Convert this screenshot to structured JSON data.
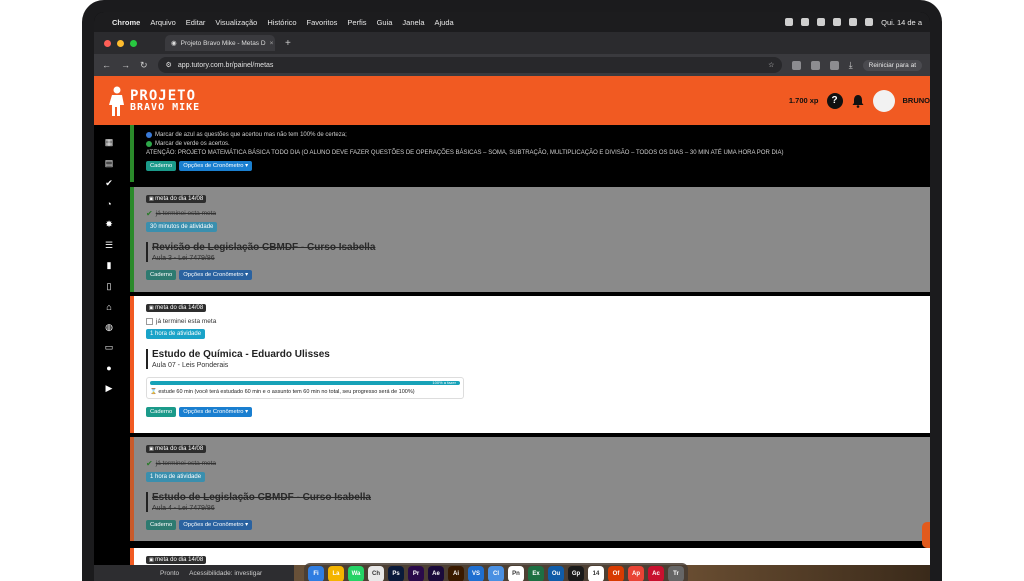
{
  "menubar": {
    "app": "Chrome",
    "items": [
      "Arquivo",
      "Editar",
      "Visualização",
      "Histórico",
      "Favoritos",
      "Perfis",
      "Guia",
      "Janela",
      "Ajuda"
    ],
    "clock": "Qui. 14 de a"
  },
  "browser": {
    "tab_title": "Projeto Bravo Mike - Metas D",
    "url": "app.tutory.com.br/painel/metas",
    "relaunch_label": "Reiniciar para at"
  },
  "header": {
    "logo_line1": "PROJETO",
    "logo_line2": "BRAVO MIKE",
    "xp": "1.700 xp",
    "help": "?",
    "user": "BRUNO"
  },
  "top_card": {
    "line1": "Marcar de azul as questões que acertou mas não tem 100% de certeza;",
    "line2": "Marcar de verde os acertos.",
    "line3": "ATENÇÃO: PROJETO MATEMÁTICA BÁSICA TODO DIA (O ALUNO DEVE FAZER QUESTÕES DE OPERAÇÕES BÁSICAS – SOMA, SUBTRAÇÃO, MULTIPLICAÇÃO E DIVISÃO – TODOS OS DIAS – 30 MIN ATÉ UMA HORA POR DIA)",
    "btn_caderno": "Caderno",
    "btn_cronometro": "Opções de Cronômetro ▾"
  },
  "cards": [
    {
      "date": "meta do dia 14/08",
      "check": "já terminei esta meta",
      "time": "30 minutos de atividade",
      "title": "Revisão de Legislação CBMDF - Curso Isabella",
      "sub": "Aula 3 - Lei 7479/86",
      "btn_caderno": "Caderno",
      "btn_cronometro": "Opções de Cronômetro ▾"
    },
    {
      "date": "meta do dia 14/08",
      "check": "já terminei esta meta",
      "time": "1 hora de atividade",
      "title": "Estudo de Química - Eduardo Ulisses",
      "sub": "Aula 07 - Leis Ponderais",
      "progress_label": "100% a fazer",
      "progress_value": 100,
      "progress_note": "⌛ estude 60 min (você terá estudado 60 min e o assunto tem 60 min no total, seu progresso será de 100%)",
      "btn_caderno": "Caderno",
      "btn_cronometro": "Opções de Cronômetro ▾"
    },
    {
      "date": "meta do dia 14/08",
      "check": "já terminei esta meta",
      "time": "1 hora de atividade",
      "title": "Estudo de Legislação CBMDF - Curso Isabella",
      "sub": "Aula 4 - Lei 7479/86",
      "btn_caderno": "Caderno",
      "btn_cronometro": "Opções de Cronômetro ▾"
    },
    {
      "date": "meta do dia 14/08"
    }
  ],
  "statusbar": {
    "left": "Pronto",
    "access": "Acessibilidade: investigar"
  },
  "dock": [
    "Fi",
    "La",
    "Wa",
    "Ch",
    "Ps",
    "Pr",
    "Ae",
    "Ai",
    "VS",
    "Cl",
    "Pn",
    "Ex",
    "Ou",
    "Gp",
    "14",
    "Of",
    "Ap",
    "Ac",
    "Tr"
  ],
  "colors": {
    "brand": "#f15a22",
    "done_border": "#2a8a2a",
    "active_border": "#f15a22",
    "teal": "#1aa3c8",
    "blue_btn": "#1a7fd0"
  }
}
